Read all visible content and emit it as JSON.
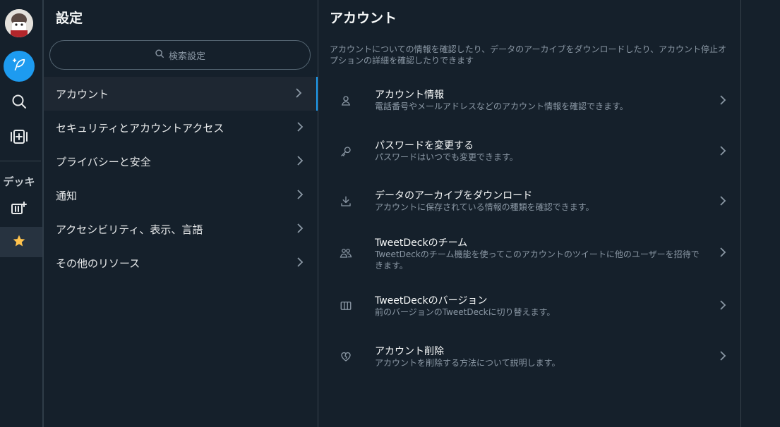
{
  "rail": {
    "avatar": "user-avatar",
    "deck_label": "デッキ"
  },
  "settings": {
    "title": "設定",
    "search_placeholder": "検索設定",
    "items": [
      {
        "label": "アカウント",
        "active": true
      },
      {
        "label": "セキュリティとアカウントアクセス"
      },
      {
        "label": "プライバシーと安全"
      },
      {
        "label": "通知"
      },
      {
        "label": "アクセシビリティ、表示、言語"
      },
      {
        "label": "その他のリソース"
      }
    ]
  },
  "detail": {
    "title": "アカウント",
    "description": "アカウントについての情報を確認したり、データのアーカイブをダウンロードしたり、アカウント停止オプションの詳細を確認したりできます",
    "options": [
      {
        "icon": "person-icon",
        "title": "アカウント情報",
        "desc": "電話番号やメールアドレスなどのアカウント情報を確認できます。"
      },
      {
        "icon": "key-icon",
        "title": "パスワードを変更する",
        "desc": "パスワードはいつでも変更できます。"
      },
      {
        "icon": "download-icon",
        "title": "データのアーカイブをダウンロード",
        "desc": "アカウントに保存されている情報の種類を確認できます。"
      },
      {
        "icon": "team-icon",
        "title": "TweetDeckのチーム",
        "desc": "TweetDeckのチーム機能を使ってこのアカウントのツイートに他のユーザーを招待できます。"
      },
      {
        "icon": "columns-icon",
        "title": "TweetDeckのバージョン",
        "desc": "前のバージョンのTweetDeckに切り替えます。"
      },
      {
        "icon": "broken-heart-icon",
        "title": "アカウント削除",
        "desc": "アカウントを削除する方法について説明します。"
      }
    ]
  },
  "colors": {
    "background": "#15202b",
    "accent": "#1d9bf0",
    "active_row": "#1e2732",
    "secondary_text": "#8b98a5",
    "star": "#ffc34d"
  }
}
